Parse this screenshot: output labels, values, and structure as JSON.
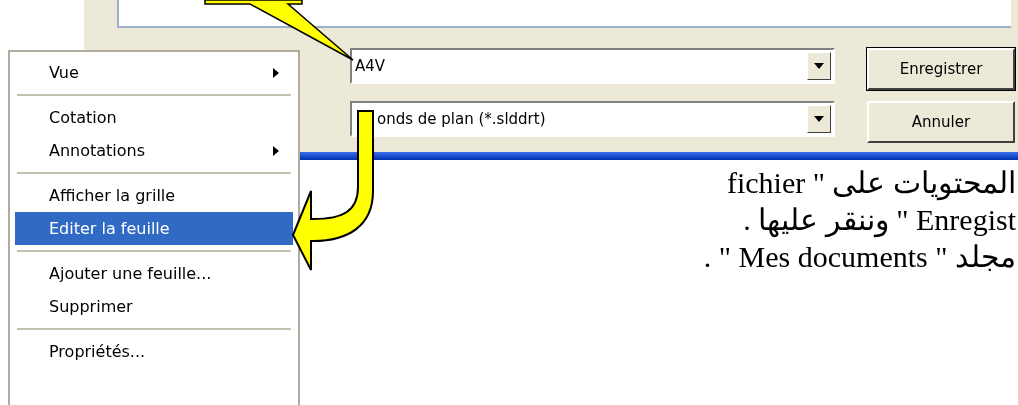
{
  "context_menu": {
    "items": [
      {
        "kind": "item",
        "label": "Vue",
        "submenu": true,
        "selected": false
      },
      {
        "kind": "separator"
      },
      {
        "kind": "item",
        "label": "Cotation",
        "submenu": false,
        "selected": false
      },
      {
        "kind": "item",
        "label": "Annotations",
        "submenu": true,
        "selected": false
      },
      {
        "kind": "separator"
      },
      {
        "kind": "item",
        "label": "Afficher la grille",
        "submenu": false,
        "selected": false
      },
      {
        "kind": "item",
        "label": "Editer la feuille",
        "submenu": false,
        "selected": true
      },
      {
        "kind": "separator"
      },
      {
        "kind": "item",
        "label": "Ajouter une feuille...",
        "submenu": false,
        "selected": false
      },
      {
        "kind": "item",
        "label": "Supprimer",
        "submenu": false,
        "selected": false
      },
      {
        "kind": "separator"
      },
      {
        "kind": "item",
        "label": "Propriétés...",
        "submenu": false,
        "selected": false
      }
    ]
  },
  "save_dialog": {
    "file_name": {
      "value": "A4V"
    },
    "file_type": {
      "value": "onds de plan (*.slddrt)"
    },
    "buttons": [
      {
        "label": "Enregistrer",
        "default": true
      },
      {
        "label": "Annuler",
        "default": false
      }
    ]
  },
  "document_text": [
    "المحتويات على \" fichier",
    "Enregist \" وننقر عليها .",
    "مجلد \" Mes documents \" ."
  ]
}
